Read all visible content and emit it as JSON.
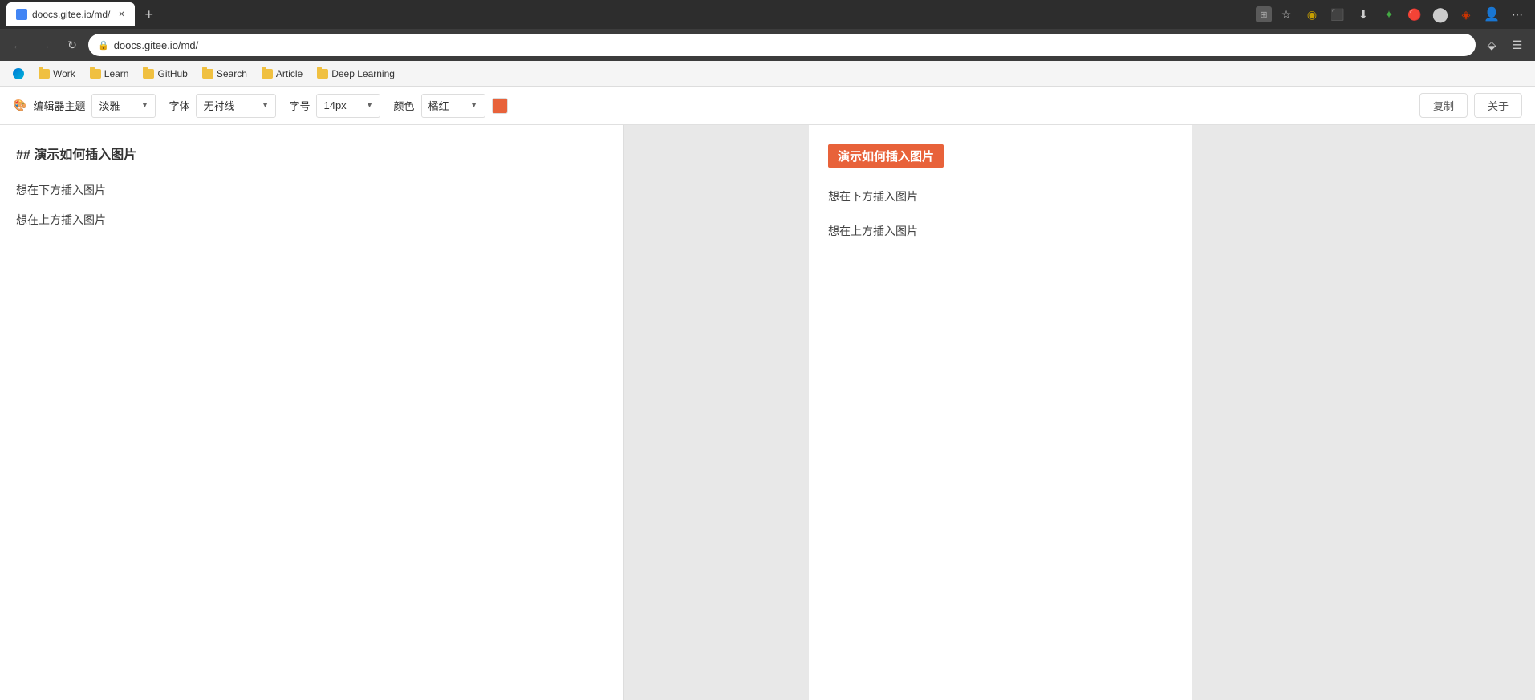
{
  "browser": {
    "tab": {
      "label": "doocs.gitee.io/md/",
      "favicon_color": "#4285f4"
    },
    "address_bar": {
      "url": "doocs.gitee.io/md/",
      "protocol": "https"
    },
    "bookmarks": [
      {
        "id": "edge-logo",
        "type": "icon",
        "label": ""
      },
      {
        "id": "work",
        "type": "folder",
        "label": "Work"
      },
      {
        "id": "learn",
        "type": "folder",
        "label": "Learn"
      },
      {
        "id": "github",
        "type": "folder",
        "label": "GitHub"
      },
      {
        "id": "search",
        "type": "folder",
        "label": "Search"
      },
      {
        "id": "article",
        "type": "folder",
        "label": "Article"
      },
      {
        "id": "deep-learning",
        "type": "folder",
        "label": "Deep Learning"
      }
    ]
  },
  "toolbar": {
    "theme_label": "编辑器主题",
    "theme_value": "淡雅",
    "font_label": "字体",
    "font_value": "无衬线",
    "size_label": "字号",
    "size_value": "14px",
    "color_label": "颜色",
    "color_value": "橘红",
    "color_hex": "#e8623a",
    "copy_button": "复制",
    "about_button": "关于"
  },
  "editor": {
    "line1": "## 演示如何插入图片",
    "line2": "想在下方插入图片",
    "line3": "想在上方插入图片"
  },
  "preview": {
    "heading": "演示如何插入图片",
    "para1": "想在下方插入图片",
    "para2": "想在上方插入图片"
  },
  "nav": {
    "back_title": "后退",
    "forward_title": "前进",
    "refresh_title": "刷新"
  }
}
